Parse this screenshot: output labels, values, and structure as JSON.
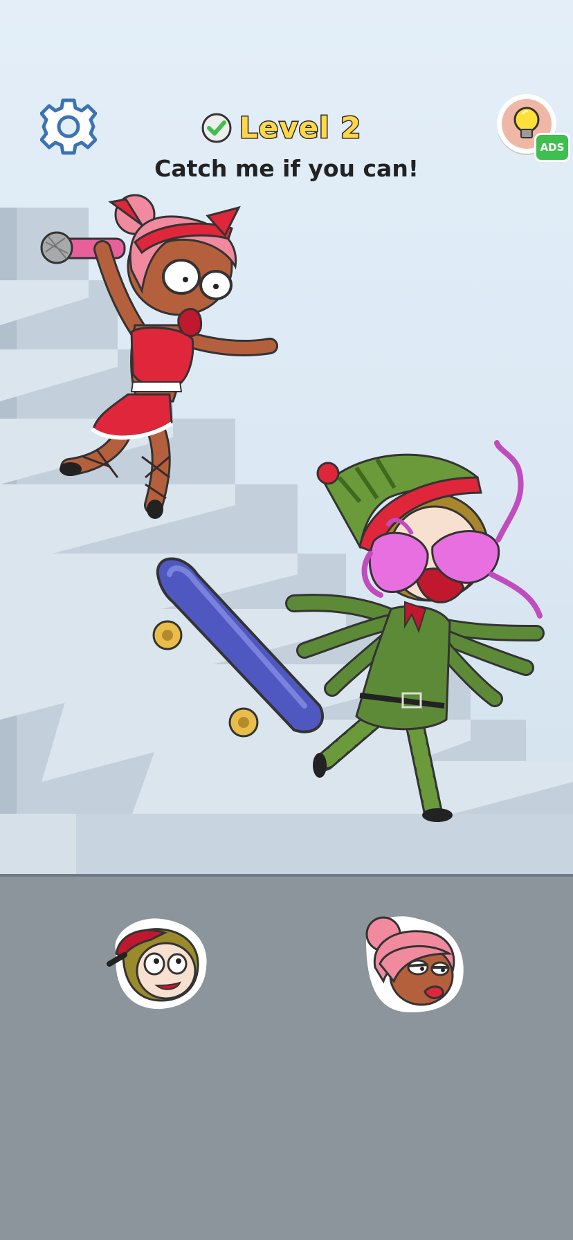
{
  "hud": {
    "level_label": "Level 2",
    "subtitle": "Catch me if you can!",
    "settings_icon": "gear-icon",
    "level_status_icon": "check-circle-icon",
    "hint_icon": "lightbulb-icon",
    "hint_badge": "ADS"
  },
  "scene": {
    "characters": [
      "girl-with-microphone",
      "elf-with-bra-on-face"
    ],
    "props": [
      "microphone",
      "skateboard",
      "pink-bra",
      "staircase"
    ]
  },
  "answer_tray": {
    "options": [
      {
        "name": "curly-hair-boy-face"
      },
      {
        "name": "pink-hair-girl-face"
      }
    ]
  },
  "colors": {
    "level_text": "#ffd84a",
    "check": "#3fbf4f",
    "ads_badge": "#3fbf4f",
    "tray": "#8d959c",
    "sky": "#e3eef8"
  }
}
